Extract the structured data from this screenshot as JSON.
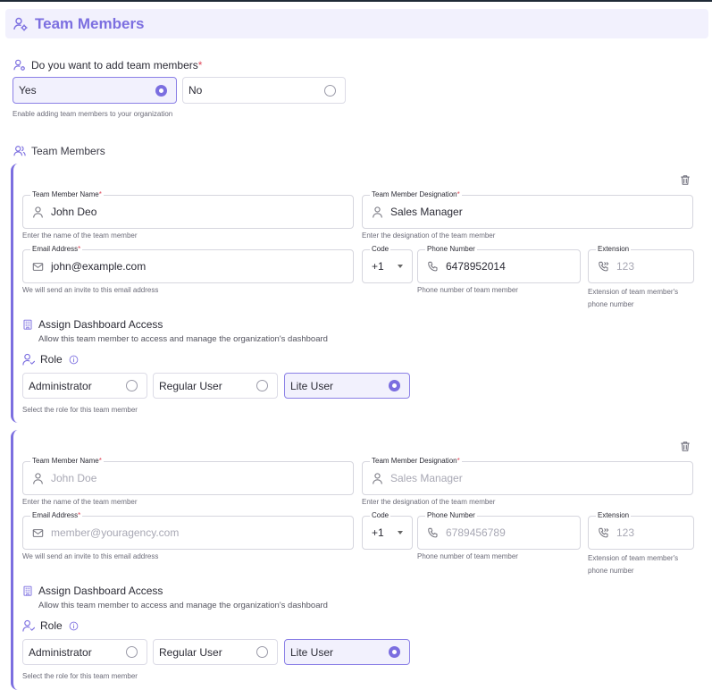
{
  "header": {
    "title": "Team Members"
  },
  "add_question": {
    "label": "Do you want to add team members",
    "required_mark": "*",
    "options": [
      {
        "label": "Yes",
        "selected": true
      },
      {
        "label": "No",
        "selected": false
      }
    ],
    "help": "Enable adding team members to your organization"
  },
  "team_section_label": "Team Members",
  "members": [
    {
      "name": {
        "legend": "Team Member Name",
        "value": "John Deo",
        "placeholder": "",
        "help": "Enter the name of the team member"
      },
      "designation": {
        "legend": "Team Member Designation",
        "value": "Sales Manager",
        "placeholder": "",
        "help": "Enter the designation of the team member"
      },
      "email": {
        "legend": "Email Address",
        "value": "john@example.com",
        "placeholder": "",
        "help": "We will send an invite to this email address"
      },
      "code": {
        "legend": "Code",
        "value": "+1"
      },
      "phone": {
        "legend": "Phone Number",
        "value": "6478952014",
        "placeholder": "",
        "help": "Phone number of team member"
      },
      "extension": {
        "legend": "Extension",
        "value": "",
        "placeholder": "123",
        "help_line1": "Extension of team member's",
        "help_line2": "phone number"
      },
      "access_title": "Assign Dashboard Access",
      "access_desc": "Allow this team member to access and manage the organization's dashboard",
      "role_label": "Role",
      "roles": [
        {
          "label": "Administrator",
          "selected": false
        },
        {
          "label": "Regular User",
          "selected": false
        },
        {
          "label": "Lite User",
          "selected": true
        }
      ],
      "role_help": "Select the role for this team member"
    },
    {
      "name": {
        "legend": "Team Member Name",
        "value": "",
        "placeholder": "John Doe",
        "help": "Enter the name of the team member"
      },
      "designation": {
        "legend": "Team Member Designation",
        "value": "",
        "placeholder": "Sales Manager",
        "help": "Enter the designation of the team member"
      },
      "email": {
        "legend": "Email Address",
        "value": "",
        "placeholder": "member@youragency.com",
        "help": "We will send an invite to this email address"
      },
      "code": {
        "legend": "Code",
        "value": "+1"
      },
      "phone": {
        "legend": "Phone Number",
        "value": "",
        "placeholder": "6789456789",
        "help": "Phone number of team member"
      },
      "extension": {
        "legend": "Extension",
        "value": "",
        "placeholder": "123",
        "help_line1": "Extension of team member's",
        "help_line2": "phone number"
      },
      "access_title": "Assign Dashboard Access",
      "access_desc": "Allow this team member to access and manage the organization's dashboard",
      "role_label": "Role",
      "roles": [
        {
          "label": "Administrator",
          "selected": false
        },
        {
          "label": "Regular User",
          "selected": false
        },
        {
          "label": "Lite User",
          "selected": true
        }
      ],
      "role_help": "Select the role for this team member"
    }
  ],
  "required_mark": "*",
  "colors": {
    "accent": "#7c6fe0",
    "required": "#e0485a",
    "header_bg": "#f2f1fd"
  },
  "icons": [
    "team-settings-icon",
    "user-icon",
    "mail-icon",
    "phone-icon",
    "phone-extension-icon",
    "building-icon",
    "user-check-icon",
    "info-icon",
    "trash-icon",
    "users-icon"
  ]
}
